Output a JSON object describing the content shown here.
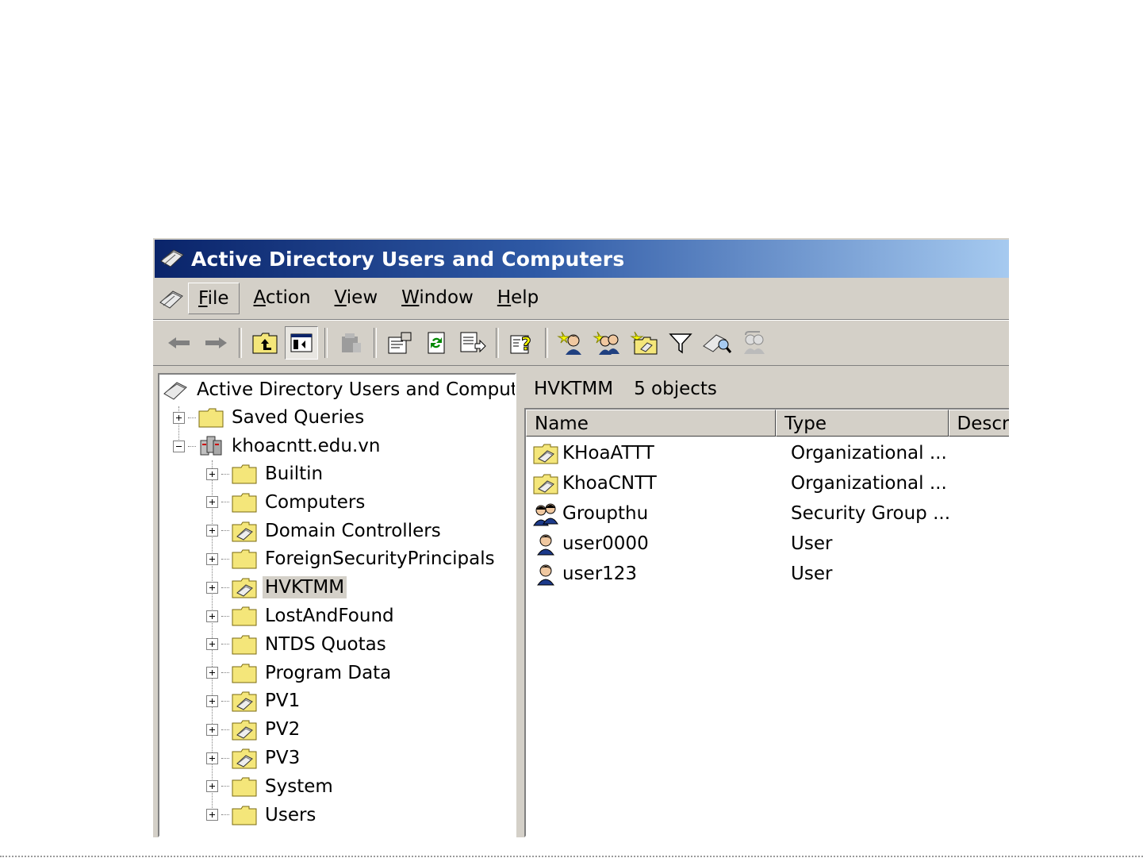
{
  "window": {
    "title": "Active Directory Users and Computers"
  },
  "menu": [
    {
      "label": "File",
      "active": true
    },
    {
      "label": "Action"
    },
    {
      "label": "View"
    },
    {
      "label": "Window"
    },
    {
      "label": "Help"
    }
  ],
  "toolbar": [
    {
      "icon": "back-arrow-icon"
    },
    {
      "icon": "forward-arrow-icon"
    },
    {
      "sep": true
    },
    {
      "icon": "up-folder-icon"
    },
    {
      "icon": "show-hide-tree-icon"
    },
    {
      "sep": true
    },
    {
      "icon": "delete-icon"
    },
    {
      "sep": true
    },
    {
      "icon": "properties-icon"
    },
    {
      "icon": "refresh-icon"
    },
    {
      "icon": "export-list-icon"
    },
    {
      "sep": true
    },
    {
      "icon": "help-icon"
    },
    {
      "sep": true
    },
    {
      "icon": "new-user-icon"
    },
    {
      "icon": "new-group-icon"
    },
    {
      "icon": "new-ou-icon"
    },
    {
      "icon": "filter-icon"
    },
    {
      "icon": "find-icon"
    },
    {
      "icon": "add-to-group-icon"
    }
  ],
  "tree": {
    "root": "Active Directory Users and Computer",
    "saved_queries": "Saved Queries",
    "domain": "khoacntt.edu.vn",
    "children": [
      {
        "label": "Builtin",
        "type": "folder"
      },
      {
        "label": "Computers",
        "type": "folder"
      },
      {
        "label": "Domain Controllers",
        "type": "ou"
      },
      {
        "label": "ForeignSecurityPrincipals",
        "type": "folder"
      },
      {
        "label": "HVKTMM",
        "type": "ou",
        "selected": true
      },
      {
        "label": "LostAndFound",
        "type": "folder"
      },
      {
        "label": "NTDS Quotas",
        "type": "folder"
      },
      {
        "label": "Program Data",
        "type": "folder"
      },
      {
        "label": "PV1",
        "type": "ou"
      },
      {
        "label": "PV2",
        "type": "ou"
      },
      {
        "label": "PV3",
        "type": "ou"
      },
      {
        "label": "System",
        "type": "folder"
      },
      {
        "label": "Users",
        "type": "folder"
      }
    ]
  },
  "details": {
    "container": "HVKTMM",
    "count": "5 objects",
    "columns": [
      "Name",
      "Type",
      "Descr"
    ],
    "rows": [
      {
        "name": "KHoaATTT",
        "type": "Organizational ...",
        "icon": "ou"
      },
      {
        "name": "KhoaCNTT",
        "type": "Organizational ...",
        "icon": "ou"
      },
      {
        "name": "Groupthu",
        "type": "Security Group ...",
        "icon": "group"
      },
      {
        "name": "user0000",
        "type": "User",
        "icon": "user"
      },
      {
        "name": "user123",
        "type": "User",
        "icon": "user"
      }
    ]
  }
}
